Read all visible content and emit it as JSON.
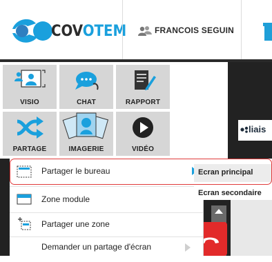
{
  "header": {
    "logo_text_dark": "COV",
    "logo_text_blue": "OTEM",
    "user_name": "FRANCOIS SEGUIN"
  },
  "tools": [
    {
      "label": "VISIO",
      "icon": "video-conference-icon"
    },
    {
      "label": "CHAT",
      "icon": "chat-bubble-icon"
    },
    {
      "label": "RAPPORT",
      "icon": "report-pen-icon"
    },
    {
      "label": "PARTAGE",
      "icon": "share-arrows-icon"
    },
    {
      "label": "IMAGERIE",
      "icon": "imagery-photos-icon"
    },
    {
      "label": "VIDÉO",
      "icon": "play-circle-icon"
    }
  ],
  "sidebar_right": {
    "liaison_label": "liais"
  },
  "context_menu": {
    "items": [
      {
        "label": "Partager le bureau",
        "icon": "desktop-share-icon",
        "has_submenu": true
      },
      {
        "label": "Zone module",
        "icon": "module-zone-icon",
        "has_submenu": false
      },
      {
        "label": "Partager une zone",
        "icon": "zone-select-icon",
        "has_submenu": false
      },
      {
        "label": "Demander un partage d'écran",
        "icon": "request-share-icon",
        "has_submenu": true
      }
    ]
  },
  "submenu": {
    "items": [
      {
        "label": "Ecran principal",
        "active": true
      },
      {
        "label": "Ecran secondaire",
        "active": false
      }
    ]
  },
  "colors": {
    "brand_blue": "#1aa0dd",
    "tile_bg": "#d6d6d6",
    "highlight_red": "#e03a3a",
    "hangup_red": "#e22a2a",
    "dark_bg": "#222222"
  }
}
